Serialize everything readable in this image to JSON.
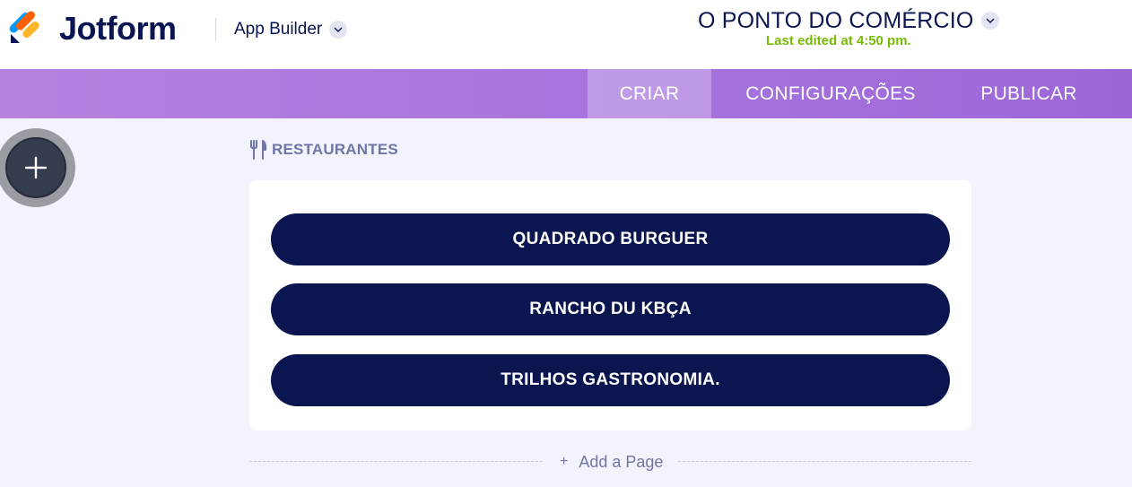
{
  "header": {
    "brand": "Jotform",
    "product_menu": "App Builder",
    "app_title": "O PONTO DO COMÉRCIO",
    "last_edited": "Last edited at 4:50 pm.",
    "logo_colors": [
      "#0099ff",
      "#ff6100",
      "#ffb629",
      "#0a1551"
    ]
  },
  "nav": {
    "tabs": [
      {
        "label": "CRIAR",
        "active": true
      },
      {
        "label": "CONFIGURAÇÕES",
        "active": false
      },
      {
        "label": "PUBLICAR",
        "active": false
      }
    ]
  },
  "add_element": {
    "icon": "plus-icon"
  },
  "page": {
    "icon": "utensils-icon",
    "label": "RESTAURANTES",
    "buttons": [
      {
        "label": "QUADRADO BURGUER"
      },
      {
        "label": "RANCHO DU KBÇA"
      },
      {
        "label": "TRILHOS GASTRONOMIA."
      }
    ]
  },
  "add_page": {
    "label": "Add a Page"
  },
  "colors": {
    "button_bg": "#0b1650",
    "last_edited": "#78bb07",
    "nav_gradient_start": "#b582e1",
    "nav_gradient_end": "#9c66d8",
    "page_bg": "#f3f3fe"
  }
}
